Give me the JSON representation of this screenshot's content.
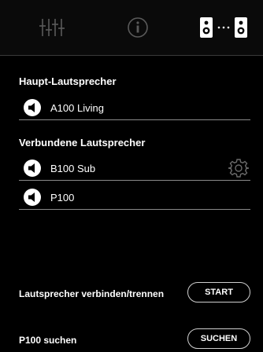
{
  "tabs": [
    {
      "icon": "equalizer-icon"
    },
    {
      "icon": "info-icon"
    },
    {
      "icon": "speakers-link-icon"
    }
  ],
  "main_speaker": {
    "title": "Haupt-Lautsprecher",
    "items": [
      {
        "label": "A100 Living",
        "icon": "speaker-icon"
      }
    ]
  },
  "connected_speakers": {
    "title": "Verbundene Lautsprecher",
    "items": [
      {
        "label": "B100 Sub",
        "icon": "speaker-icon",
        "settings_icon": "gear-icon"
      },
      {
        "label": "P100",
        "icon": "speaker-icon"
      }
    ]
  },
  "actions": [
    {
      "label": "Lautsprecher verbinden/trennen",
      "button": "START"
    },
    {
      "label": "P100 suchen",
      "button": "SUCHEN"
    }
  ]
}
